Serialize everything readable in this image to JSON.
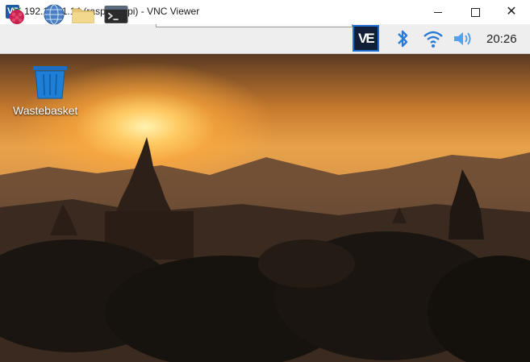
{
  "window": {
    "title": "192.168.1.14 (raspberrypi) - VNC Viewer",
    "app_icon": "vnc-viewer-icon"
  },
  "panel": {
    "launchers": [
      "raspberry-menu-icon",
      "web-browser-globe-icon",
      "file-manager-folder-icon",
      "terminal-icon"
    ],
    "tray": [
      "vnc-server-icon",
      "bluetooth-icon",
      "wifi-icon",
      "volume-icon"
    ],
    "clock": "20:26"
  },
  "desktop": {
    "icons": [
      {
        "label": "Wastebasket",
        "icon": "wastebasket-icon"
      }
    ],
    "wallpaper": "sunset-temples-photo"
  },
  "colors": {
    "vnc_blue": "#1e6fd0",
    "panel_bg": "#eeeeee",
    "tray_blue": "#2b7bd6"
  }
}
